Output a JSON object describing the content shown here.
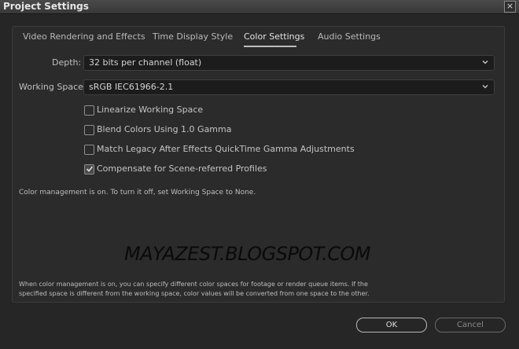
{
  "window": {
    "title": "Project Settings",
    "close_glyph": "×"
  },
  "tabs": [
    {
      "label": "Video Rendering and Effects",
      "active": false
    },
    {
      "label": "Time Display Style",
      "active": false
    },
    {
      "label": "Color Settings",
      "active": true
    },
    {
      "label": "Audio Settings",
      "active": false
    }
  ],
  "depth": {
    "label": "Depth:",
    "value": "32 bits per channel (float)"
  },
  "working_space": {
    "label": "Working Space:",
    "value": "sRGB IEC61966-2.1"
  },
  "options": [
    {
      "label": "Linearize Working Space",
      "checked": false
    },
    {
      "label": "Blend Colors Using 1.0 Gamma",
      "checked": false
    },
    {
      "label": "Match Legacy After Effects QuickTime Gamma Adjustments",
      "checked": false
    },
    {
      "label": "Compensate for Scene-referred Profiles",
      "checked": true
    }
  ],
  "status_text": "Color management is on. To turn it off, set Working Space to None.",
  "watermark": "MAYAZEST.BLOGSPOT.COM",
  "footer_text": "When color management is on, you can specify different color spaces for footage or render queue items. If the specified space is different from the working space, color values will be converted from one space to the other.",
  "buttons": {
    "ok": "OK",
    "cancel": "Cancel"
  },
  "colors": {
    "background": "#262626",
    "panel": "#2b2b2b",
    "text": "#c8c8c8"
  }
}
